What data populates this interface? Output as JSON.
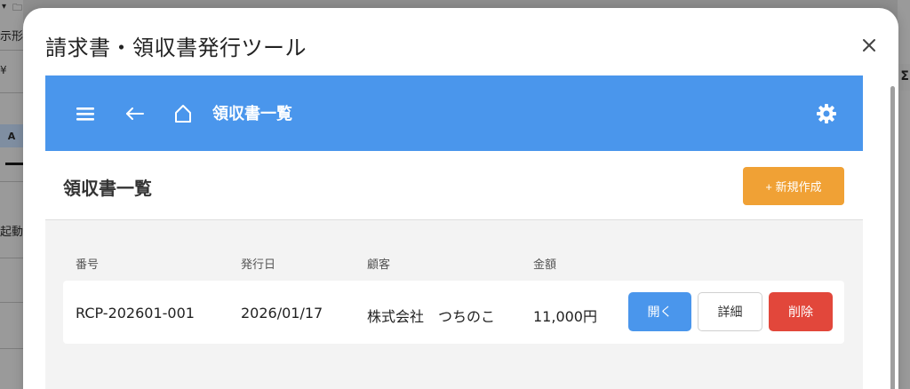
{
  "background_app": {
    "glyphs": {
      "tab_text": "示形",
      "yen": "¥",
      "column_a": "A",
      "text_fragment": "起動」",
      "sigma": "Σ"
    }
  },
  "dialog": {
    "title": "請求書・領収書発行ツール",
    "close_label": "×"
  },
  "app": {
    "header": {
      "title": "領収書一覧",
      "menu_icon": "hamburger-icon",
      "back_icon": "back-arrow-icon",
      "home_icon": "home-icon",
      "settings_icon": "gear-icon",
      "color": "#4a96ec"
    },
    "page": {
      "title": "領収書一覧",
      "new_button_label": "+ 新規作成",
      "new_button_color": "#f0a135"
    },
    "table": {
      "columns": [
        "番号",
        "発行日",
        "顧客",
        "金額"
      ],
      "rows": [
        {
          "number": "RCP-202601-001",
          "date": "2026/01/17",
          "customer": "株式会社　つちのこ",
          "amount": "11,000円"
        }
      ],
      "actions": {
        "open": "開く",
        "detail": "詳細",
        "delete": "削除"
      },
      "action_colors": {
        "open": "#4a96ec",
        "delete": "#e2473b"
      }
    }
  }
}
